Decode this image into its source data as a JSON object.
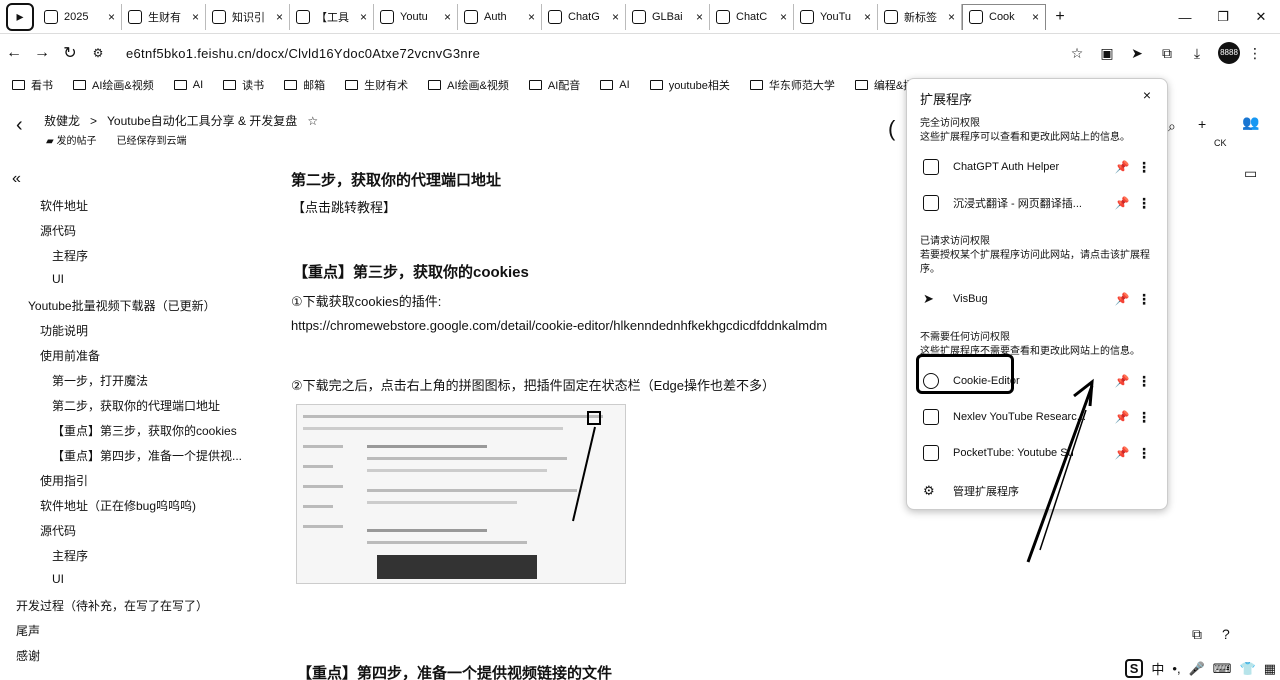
{
  "browser": {
    "tabs": [
      {
        "label": "2025",
        "icon": "doc-icon"
      },
      {
        "label": "生财有",
        "icon": "loading-icon"
      },
      {
        "label": "知识引",
        "icon": "loading-icon"
      },
      {
        "label": "【工具",
        "icon": "loading-icon"
      },
      {
        "label": "Youtu",
        "icon": "page-icon"
      },
      {
        "label": "Auth",
        "icon": "auth-icon"
      },
      {
        "label": "ChatG",
        "icon": "chat-icon"
      },
      {
        "label": "GLBai",
        "icon": "glb-icon"
      },
      {
        "label": "ChatC",
        "icon": "openai-icon"
      },
      {
        "label": "YouTu",
        "icon": "youtube-icon"
      },
      {
        "label": "新标签",
        "icon": "chrome-icon"
      },
      {
        "label": "Cook",
        "icon": "cookie-icon"
      }
    ],
    "new_tab": "+",
    "url": "e6tnf5bko1.feishu.cn/docx/Clvld16Ydoc0Atxe72vcnvG3nre",
    "bookmarks": [
      "看书",
      "AI绘画&视频",
      "AI",
      "读书",
      "邮箱",
      "生财有术",
      "AI绘画&视频",
      "AI配音",
      "AI",
      "youtube相关",
      "华东师范大学",
      "编程&提示词相关"
    ],
    "avatar_text": "8888"
  },
  "doc": {
    "breadcrumb_owner": "敖健龙",
    "breadcrumb_sep": ">",
    "title": "Youtube自动化工具分享 & 开发复盘",
    "star": "☆",
    "folder": "发的帖子",
    "save_status": "已经保存到云端"
  },
  "outline": {
    "collapse": "«",
    "items": [
      "软件地址",
      "源代码",
      "主程序",
      "UI",
      "Youtube批量视频下载器（已更新）",
      "功能说明",
      "使用前准备",
      "第一步，打开魔法",
      "第二步，获取你的代理端口地址",
      "【重点】第三步，获取你的cookies",
      "【重点】第四步，准备一个提供视...",
      "使用指引",
      "软件地址（正在修bug呜呜呜)",
      "源代码",
      "主程序",
      "UI",
      "开发过程（待补充，在写了在写了）",
      "尾声",
      "感谢"
    ]
  },
  "content": {
    "step2_heading": "第二步，获取你的代理端口地址",
    "step2_link": "【点击跳转教程】",
    "step3_heading": "【重点】第三步，获取你的cookies",
    "step3_p1": "①下载获取cookies的插件:",
    "step3_url": "https://chromewebstore.google.com/detail/cookie-editor/hlkenndednhfkekhgcdicdfddnkalmdm",
    "step3_p2": "②下载完之后，点击右上角的拼图图标，把插件固定在状态栏（Edge操作也差不多）",
    "step4_heading": "【重点】第四步，准备一个提供视频链接的文件"
  },
  "extensions_popup": {
    "title": "扩展程序",
    "close": "×",
    "section_full": "完全访问权限",
    "section_full_desc": "这些扩展程序可以查看和更改此网站上的信息。",
    "section_request": "已请求访问权限",
    "section_request_desc": "若要授权某个扩展程序访问此网站，请点击该扩展程序。",
    "section_none": "不需要任何访问权限",
    "section_none_desc": "这些扩展程序不需要查看和更改此网站上的信息。",
    "full_access": [
      "ChatGPT Auth Helper",
      "沉浸式翻译 - 网页翻译插..."
    ],
    "requested": [
      "VisBug"
    ],
    "no_access": [
      "Cookie-Editor",
      "Nexlev YouTube Researc...",
      "PocketTube: Youtube Su"
    ],
    "manage": "管理扩展程序"
  },
  "taskbar": {
    "ime_logo": "S",
    "lang": "中"
  }
}
